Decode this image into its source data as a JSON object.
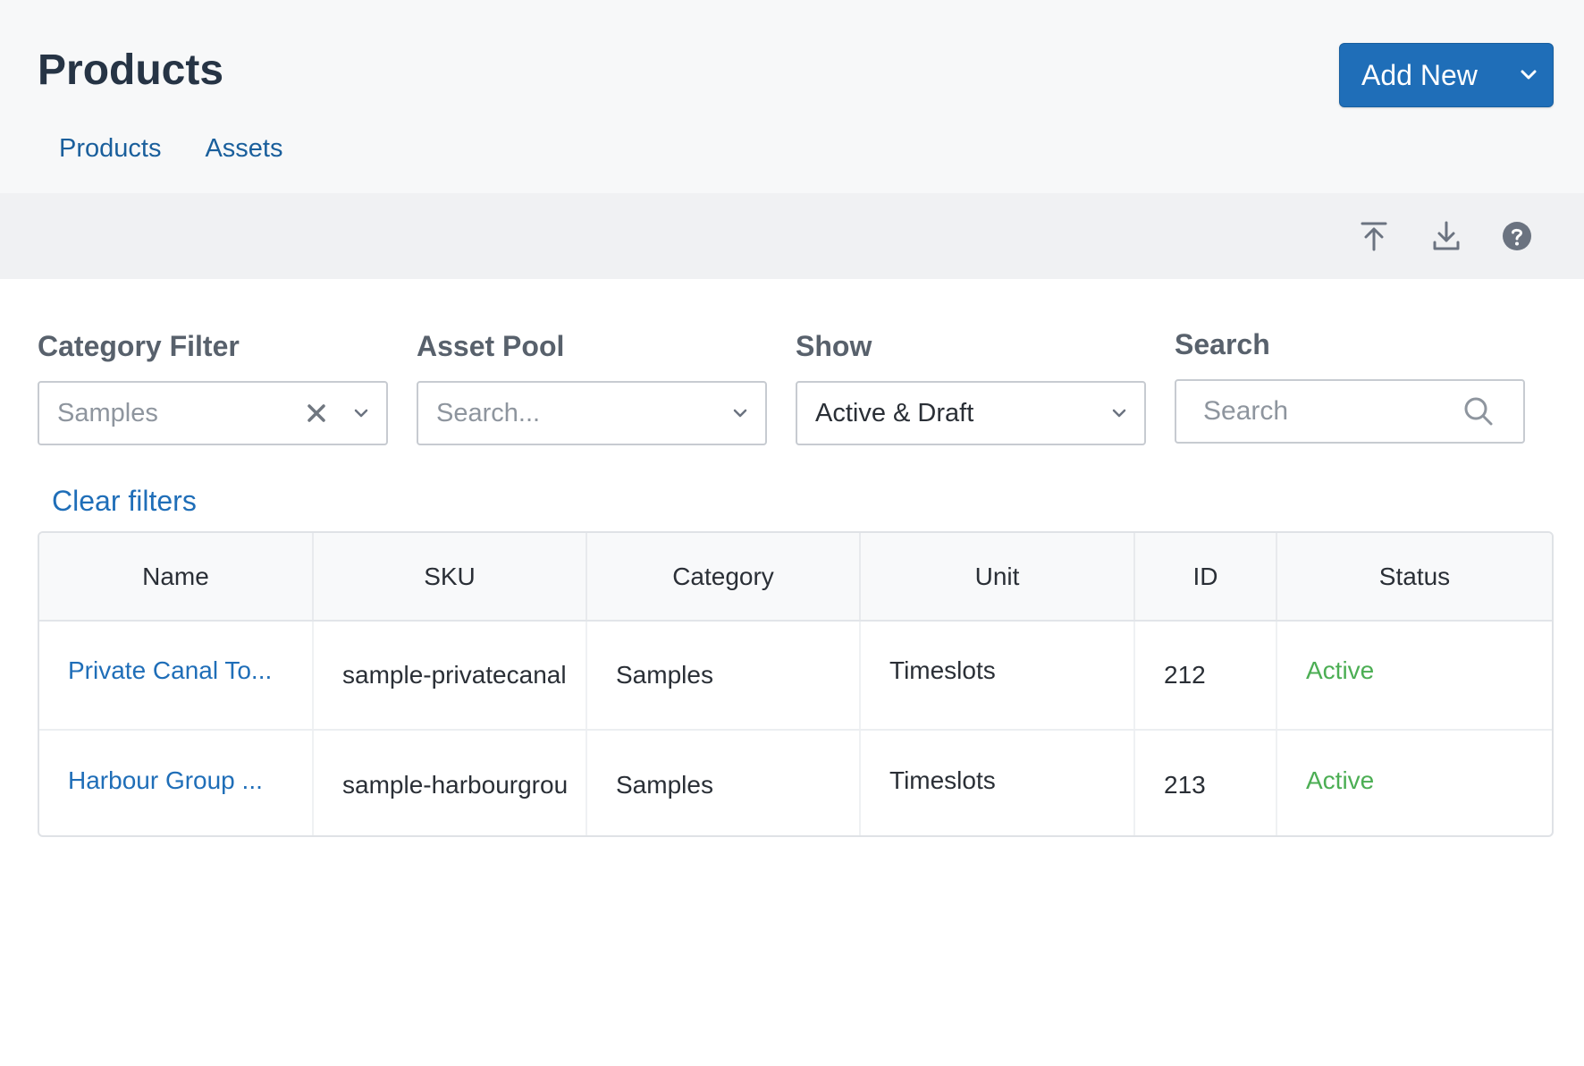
{
  "header": {
    "title": "Products",
    "add_new_label": "Add New",
    "tabs": [
      {
        "label": "Products"
      },
      {
        "label": "Assets"
      }
    ]
  },
  "toolbar": {
    "icons": [
      "upload-icon",
      "download-icon",
      "help-icon"
    ]
  },
  "filters": {
    "category": {
      "label": "Category Filter",
      "value": "Samples"
    },
    "asset_pool": {
      "label": "Asset Pool",
      "placeholder": "Search..."
    },
    "show": {
      "label": "Show",
      "value": "Active & Draft"
    },
    "search": {
      "label": "Search",
      "placeholder": "Search"
    },
    "clear_label": "Clear filters"
  },
  "table": {
    "columns": [
      "Name",
      "SKU",
      "Category",
      "Unit",
      "ID",
      "Status"
    ],
    "rows": [
      {
        "name": "Private Canal To...",
        "sku": "sample-privatecanal",
        "category": "Samples",
        "unit": "Timeslots",
        "id": "212",
        "status": "Active"
      },
      {
        "name": "Harbour Group ...",
        "sku": "sample-harbourgrou",
        "category": "Samples",
        "unit": "Timeslots",
        "id": "213",
        "status": "Active"
      }
    ]
  },
  "colors": {
    "primary": "#1f6eb8",
    "link": "#1a5f9c",
    "status_active": "#4cae54"
  }
}
